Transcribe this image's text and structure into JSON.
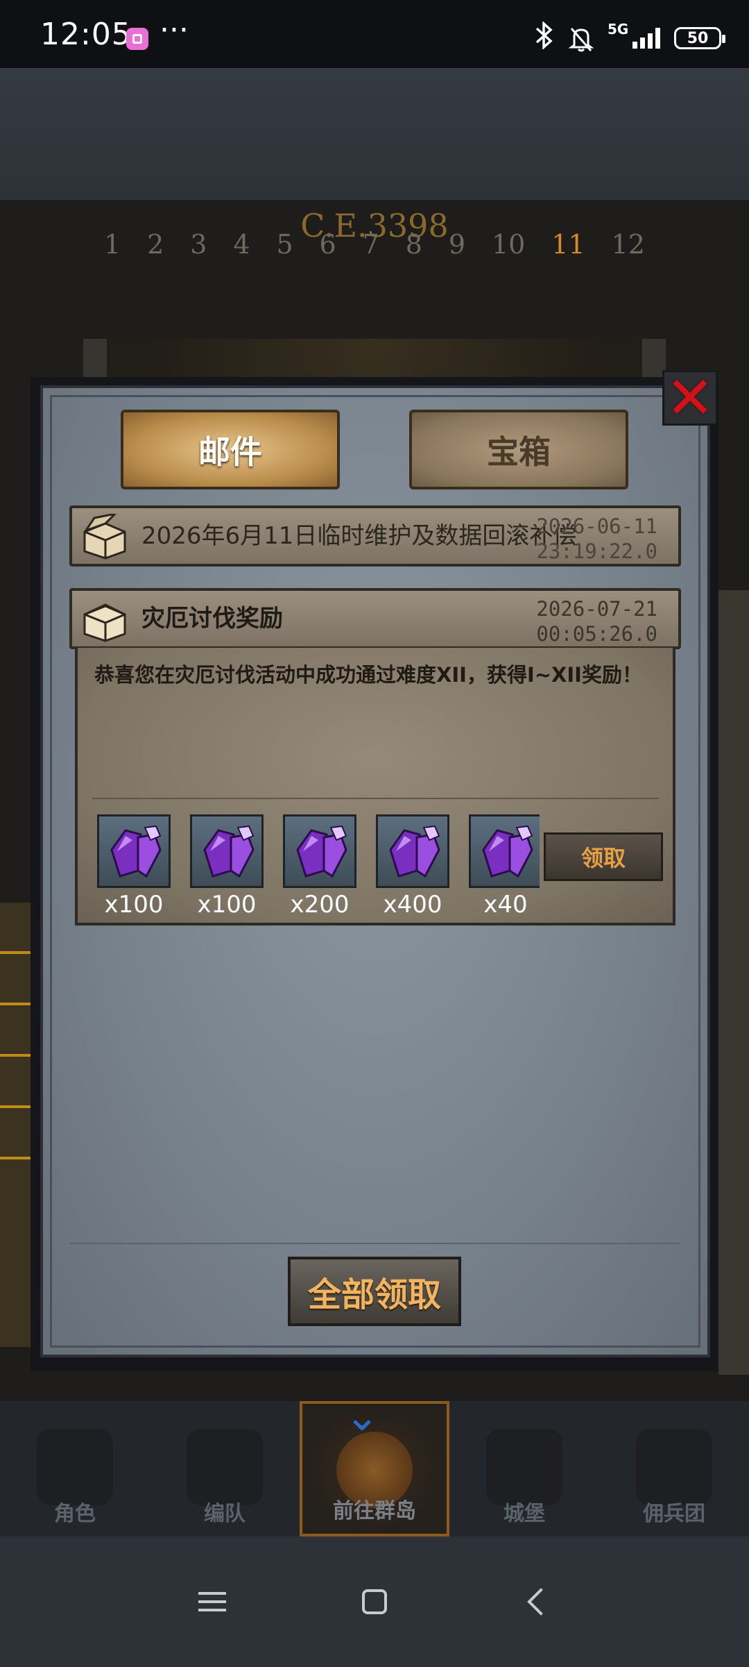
{
  "status_bar": {
    "time": "12:05",
    "more": "···",
    "network": "5G",
    "battery": "50"
  },
  "background": {
    "year": "C.E.3398",
    "dial_numbers": [
      "1",
      "2",
      "3",
      "4",
      "5",
      "6",
      "7",
      "8",
      "9",
      "10",
      "11",
      "12"
    ]
  },
  "tabs": {
    "mail": "邮件",
    "chest": "宝箱"
  },
  "mails": [
    {
      "title": "2026年6月11日临时维护及数据回滚补偿",
      "date": "2026-06-11",
      "time": "23:19:22.0"
    },
    {
      "title": "灾厄讨伐奖励",
      "date": "2026-07-21",
      "time": "00:05:26.0",
      "body": "恭喜您在灾厄讨伐活动中成功通过难度XII，获得I~XII奖励！",
      "rewards": [
        {
          "icon": "purple-crystal-icon",
          "qty": "x100"
        },
        {
          "icon": "purple-crystal-icon",
          "qty": "x100"
        },
        {
          "icon": "purple-crystal-icon",
          "qty": "x200"
        },
        {
          "icon": "purple-crystal-icon",
          "qty": "x400"
        },
        {
          "icon": "purple-crystal-icon",
          "qty": "x40"
        }
      ],
      "claim_label": "领取"
    }
  ],
  "claim_all_label": "全部领取",
  "game_nav": [
    {
      "label": "角色",
      "icon": "knight-icon"
    },
    {
      "label": "编队",
      "icon": "helmet-icon"
    },
    {
      "label": "前往群岛",
      "icon": "globe-icon"
    },
    {
      "label": "城堡",
      "icon": "castle-icon"
    },
    {
      "label": "佣兵团",
      "icon": "swords-icon"
    }
  ],
  "colors": {
    "accent": "#e8a045",
    "close": "#d0121b",
    "crystal": "#8a3fd0"
  }
}
